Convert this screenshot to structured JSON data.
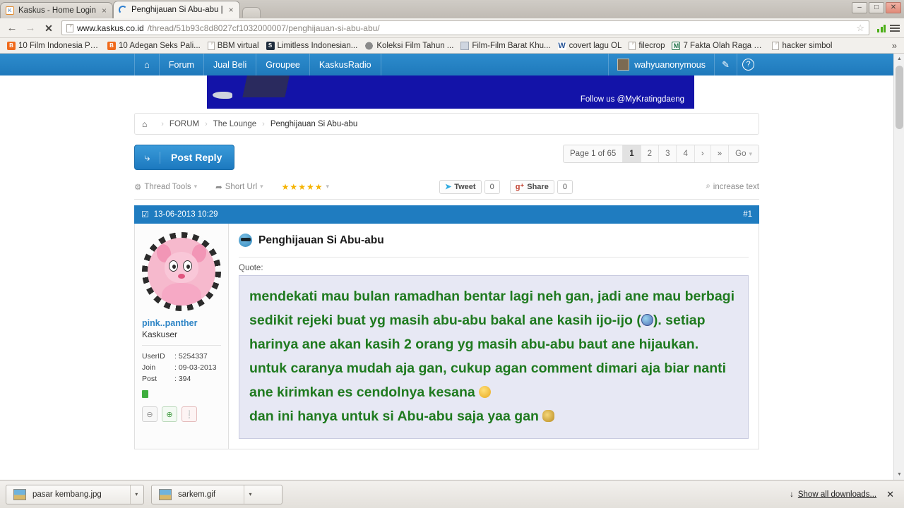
{
  "browser": {
    "tabs": [
      {
        "title": "Kaskus - Home Login",
        "close": "×",
        "icon": "kaskus-favicon",
        "active": false
      },
      {
        "title": "Penghijauan Si Abu-abu |",
        "close": "×",
        "icon": "loading-spinner",
        "active": true
      }
    ],
    "window_controls": {
      "minimize": "–",
      "maximize": "□",
      "close": "✕"
    },
    "nav": {
      "back": "←",
      "forward": "→",
      "stop": "✕"
    },
    "omnibox": {
      "host": "www.kaskus.co.id",
      "path": "/thread/51b93c8d8027cf1032000007/penghijauan-si-abu-abu/",
      "star": "☆"
    },
    "bookmarks": [
      {
        "label": "10 Film Indonesia Pa...",
        "icon": "blogger-icon"
      },
      {
        "label": "10 Adegan Seks Pali...",
        "icon": "blogger-icon"
      },
      {
        "label": "BBM virtual",
        "icon": "document-icon"
      },
      {
        "label": "Limitless Indonesian...",
        "icon": "s-square-icon"
      },
      {
        "label": "Koleksi Film Tahun ...",
        "icon": "film-icon"
      },
      {
        "label": "Film-Film Barat Khu...",
        "icon": "picture-icon"
      },
      {
        "label": "covert lagu OL",
        "icon": "word-icon"
      },
      {
        "label": "filecrop",
        "icon": "document-icon"
      },
      {
        "label": "7 Fakta Olah Raga M...",
        "icon": "m-square-icon"
      },
      {
        "label": "hacker simbol",
        "icon": "document-icon"
      }
    ],
    "bookmarks_overflow": "»"
  },
  "site": {
    "nav_items": [
      {
        "label": "⌂",
        "name": "home"
      },
      {
        "label": "Forum",
        "name": "forum"
      },
      {
        "label": "Jual Beli",
        "name": "jual-beli"
      },
      {
        "label": "Groupee",
        "name": "groupee"
      },
      {
        "label": "KaskusRadio",
        "name": "kaskusradio"
      }
    ],
    "username": "wahyuanonymous",
    "edit_icon": "✎",
    "help_icon": "?"
  },
  "ad": {
    "follow_text": "Follow us @MyKratingdaeng"
  },
  "breadcrumb": {
    "home_icon": "⌂",
    "items": [
      "FORUM",
      "The Lounge",
      "Penghijauan Si Abu-abu"
    ],
    "separator": "›"
  },
  "toolbar": {
    "post_reply_label": "Post Reply",
    "post_reply_icon": "⤷",
    "pager": {
      "info": "Page 1 of 65",
      "pages": [
        "1",
        "2",
        "3",
        "4"
      ],
      "next": "›",
      "last": "»",
      "go_label": "Go",
      "go_caret": "▾",
      "active_page": "1"
    }
  },
  "subtools": {
    "thread_tools": "Thread Tools",
    "thread_tools_icon": "⚙",
    "short_url": "Short Url",
    "short_url_icon": "➦",
    "stars": "★★★★★",
    "caret": "▾",
    "tweet_label": "Tweet",
    "tweet_count": "0",
    "tweet_icon": "➤",
    "share_label": "Share",
    "share_count": "0",
    "share_icon": "g⁺",
    "increase_text": "increase text",
    "increase_icon": "⌕"
  },
  "post": {
    "timestamp": "13-06-2013 10:29",
    "check_icon": "☑",
    "number": "#1",
    "title": "Penghijauan Si Abu-abu",
    "quote_label": "Quote:",
    "quote_lines": [
      "mendekati mau bulan ramadhan bentar lagi neh gan, jadi ane mau berbagi sedikit rejeki buat yg masih abu-abu bakal ane kasih ijo-ijo (",
      "). setiap harinya ane akan kasih 2 orang yg masih abu-abu baut ane hijaukan. untuk caranya mudah aja gan, cukup agan comment dimari aja biar nanti ane kirimkan es cendolnya kesana ",
      "dan ini hanya untuk si Abu-abu saja yaa gan "
    ],
    "author": {
      "name": "pink..panther",
      "role": "Kaskuser",
      "userid_label": "UserID",
      "userid_value": ": 5254337",
      "join_label": "Join",
      "join_value": ": 09-03-2013",
      "post_label": "Post",
      "post_value": ": 394",
      "btn_block": "⊖",
      "btn_cendol": "⊕",
      "btn_report": "❕"
    }
  },
  "downloads": {
    "items": [
      {
        "name": "pasar kembang.jpg",
        "caret": "▾"
      },
      {
        "name": "sarkem.gif",
        "caret": "▾"
      }
    ],
    "show_all": "Show all downloads...",
    "show_all_icon": "↓",
    "close": "✕"
  },
  "colors": {
    "kaskus_blue": "#1f7cc0",
    "quote_green": "#1f7a1f",
    "quote_bg": "#e7e8f4"
  }
}
